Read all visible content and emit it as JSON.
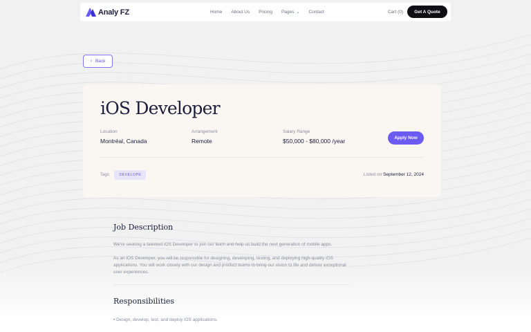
{
  "nav": {
    "brand": "Analy FZ",
    "items": [
      "Home",
      "About Us",
      "Pricing",
      "Pages",
      "Contact"
    ],
    "cart": "Cart (0)",
    "cta": "Get A Quote"
  },
  "back": {
    "label": "Back"
  },
  "job": {
    "title": "iOS Developer",
    "location_label": "Location",
    "location": "Montréal, Canada",
    "arrangement_label": "Arrangement",
    "arrangement": "Remote",
    "salary_label": "Salary Range",
    "salary": "$50,000 - $80,000 /year",
    "apply": "Apply Now",
    "tags_label": "Tags:",
    "tag": "DEVELOPE",
    "listed_prefix": "Listed on",
    "listed_date": "September 12, 2024"
  },
  "content": {
    "description_heading": "Job Description",
    "para1": "We're seeking a talented iOS Developer to join our team and help us build the next generation of mobile apps.",
    "para2": "As an iOS Developer, you will be responsible for designing, developing, testing, and deploying high-quality iOS applications. You will work closely with our design and product teams to bring our vision to life and deliver exceptional user experiences.",
    "responsibilities_heading": "Responsibilities",
    "bullet1": "Design, develop, test, and deploy iOS applications."
  },
  "colors": {
    "accent": "#6a5cf2",
    "dark": "#0e0e14",
    "card": "#faf7f3",
    "background": "#f1f1f2"
  }
}
